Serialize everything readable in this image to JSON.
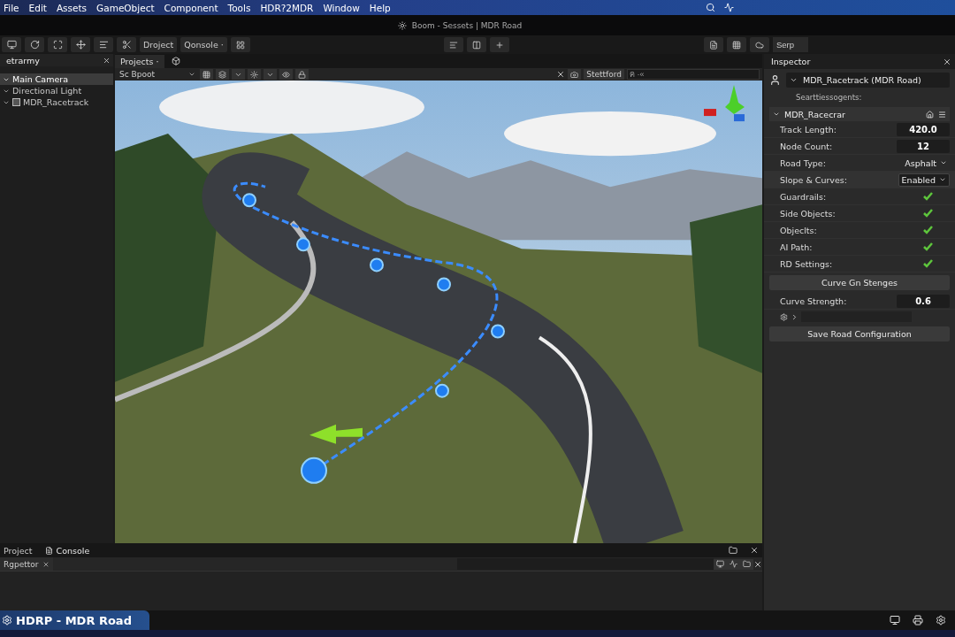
{
  "menu": [
    "File",
    "Edit",
    "Assets",
    "GameObject",
    "Component",
    "Tools",
    "HDR?2MDR",
    "Window",
    "Help"
  ],
  "title": "Boom - Sessets | MDR Road",
  "toolbar": {
    "buttons": [
      "Droject",
      "Qonsole ·"
    ],
    "search": {
      "placeholder": "Serp"
    }
  },
  "hierarchy": {
    "tab": "etrarmy",
    "items": [
      {
        "label": "Main Camera",
        "kind": "node",
        "selected": true
      },
      {
        "label": "Directional Light",
        "kind": "node",
        "selected": false
      },
      {
        "label": "MDR_Racetrack",
        "kind": "toggle",
        "selected": false,
        "checked": true
      }
    ]
  },
  "scene": {
    "tab": "Projects ·",
    "view": "Sc Bpoot",
    "mode": "Stettford",
    "search": {
      "placeholder": "ค ·«"
    }
  },
  "inspector": {
    "tab": "Inspector",
    "object": "MDR_Racetrack (MDR Road)",
    "subtitle": "Searttiessogents:",
    "component": "MDR_Racecrar",
    "fields": [
      {
        "kind": "number",
        "label": "Track Length:",
        "value": "420.0"
      },
      {
        "kind": "number",
        "label": "Node Count:",
        "value": "12"
      },
      {
        "kind": "select",
        "label": "Road Type:",
        "value": "Asphalt"
      },
      {
        "kind": "dropdown",
        "label": "Slope & Curves:",
        "value": "Enabled"
      },
      {
        "kind": "check",
        "label": "Guardrails:",
        "checked": true
      },
      {
        "kind": "check",
        "label": "Side Objects:",
        "checked": true
      },
      {
        "kind": "check",
        "label": "Objeclts:",
        "checked": true
      },
      {
        "kind": "check",
        "label": "AI Path:",
        "checked": true
      },
      {
        "kind": "check",
        "label": "RD Settings:",
        "checked": true
      }
    ],
    "curve_button": "Curve Gn Stenges",
    "strength": {
      "label": "Curve Strength:",
      "value": "0.6"
    },
    "save": "Save Road Configuration"
  },
  "bottom": {
    "tabs": [
      {
        "label": "Project",
        "selected": false
      },
      {
        "label": "Console",
        "selected": true
      }
    ],
    "subtab": "Rgpettor"
  },
  "status": "HDRP - MDR Road"
}
